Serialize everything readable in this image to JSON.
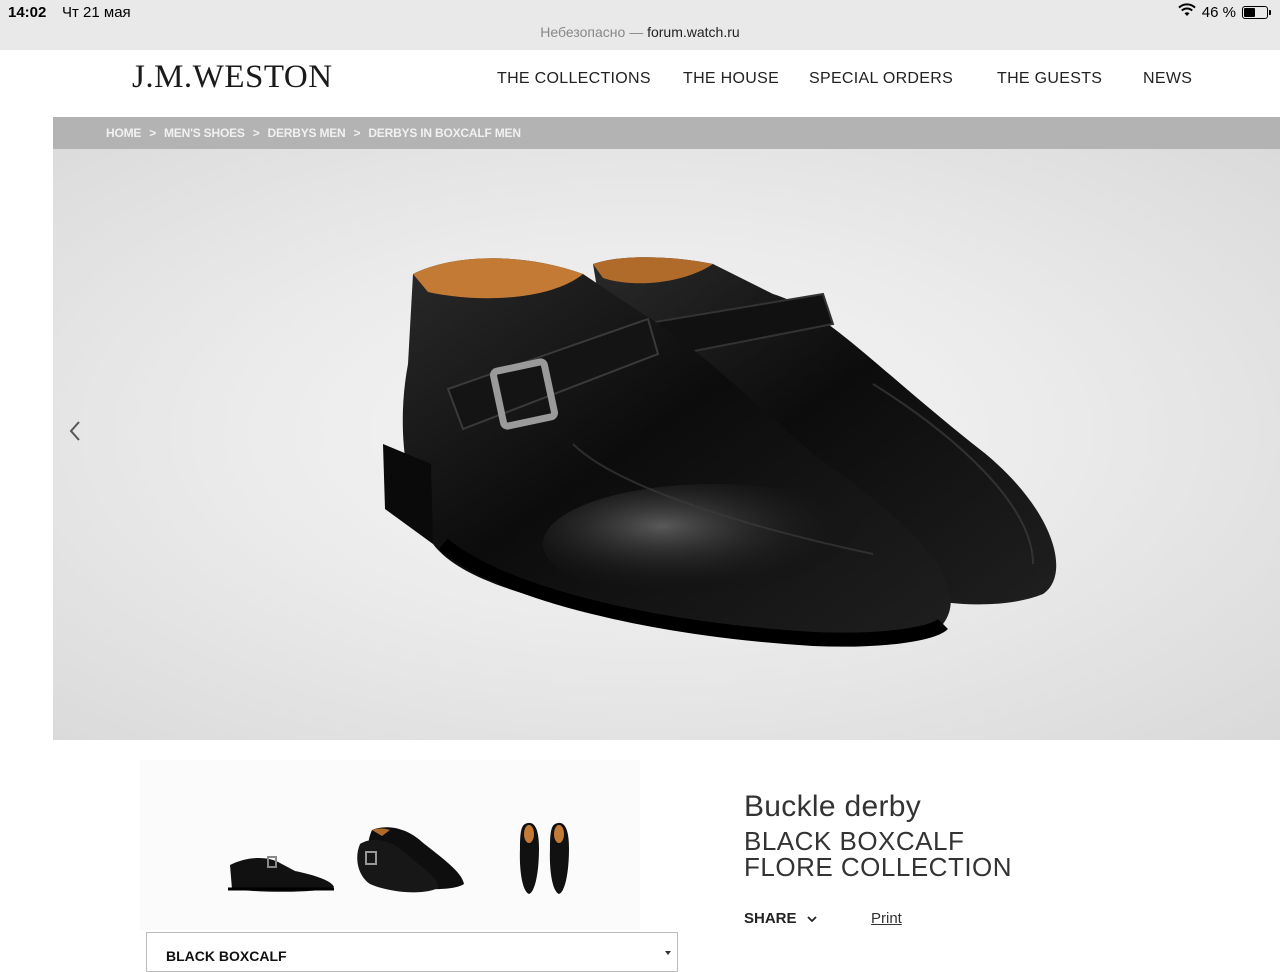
{
  "status_bar": {
    "time": "14:02",
    "date": "Чт 21 мая",
    "battery": "46 %",
    "battery_level": 0.46,
    "address_prefix": "Небезопасно —",
    "address_host": "forum.watch.ru"
  },
  "header": {
    "logo": "J.M.WESTON",
    "nav": [
      {
        "label": "THE COLLECTIONS"
      },
      {
        "label": "THE HOUSE"
      },
      {
        "label": "SPECIAL ORDERS"
      },
      {
        "label": "THE GUESTS"
      },
      {
        "label": "NEWS"
      }
    ]
  },
  "breadcrumb": {
    "separator": ">",
    "items": [
      "HOME",
      "MEN'S SHOES",
      "DERBYS MEN",
      "DERBYS IN BOXCALF MEN"
    ]
  },
  "product": {
    "title": "Buckle derby",
    "subtitle_line1": "BLACK BOXCALF",
    "subtitle_line2": "FLORE COLLECTION",
    "share_label": "SHARE",
    "print_label": "Print",
    "material_select": "BLACK BOXCALF"
  },
  "icons": {
    "prev": "chevron-left-icon",
    "share_toggle": "chevron-down-icon",
    "wifi": "wifi-icon",
    "battery": "battery-icon"
  }
}
